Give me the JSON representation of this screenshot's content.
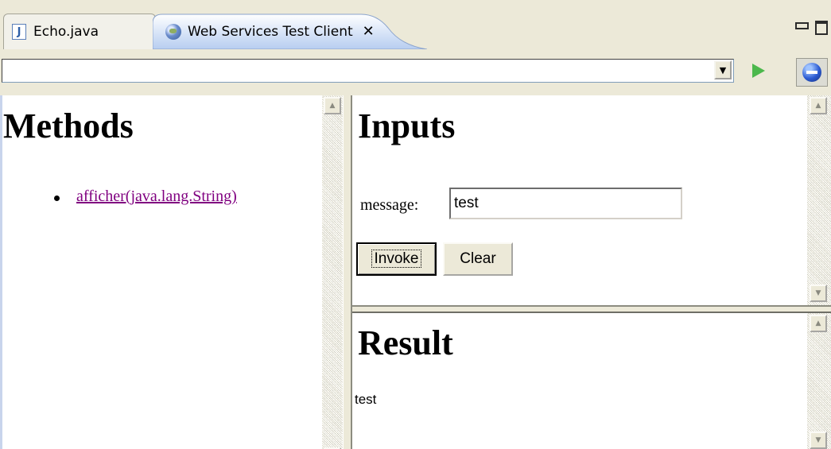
{
  "tabs": [
    {
      "label": "Echo.java",
      "icon": "java-file-icon",
      "active": false
    },
    {
      "label": "Web Services Test Client",
      "icon": "globe-icon",
      "active": true
    }
  ],
  "window_controls": {
    "minimize": "minimize-icon",
    "maximize": "maximize-icon"
  },
  "address_bar": {
    "url": "",
    "dropdown_icon": "chevron-down-icon",
    "go_icon": "play-icon",
    "nav_icon": "browser-orb-icon"
  },
  "colors": {
    "link_visited": "#800080",
    "chrome_bg": "#ece9d8",
    "active_tab_gradient_start": "#b7cdf0"
  },
  "methods": {
    "title": "Methods",
    "items": [
      {
        "label": "afficher(java.lang.String)"
      }
    ]
  },
  "inputs": {
    "title": "Inputs",
    "field_label": "message:",
    "field_value": "test",
    "invoke_label": "Invoke",
    "clear_label": "Clear"
  },
  "result": {
    "title": "Result",
    "value": "test"
  }
}
